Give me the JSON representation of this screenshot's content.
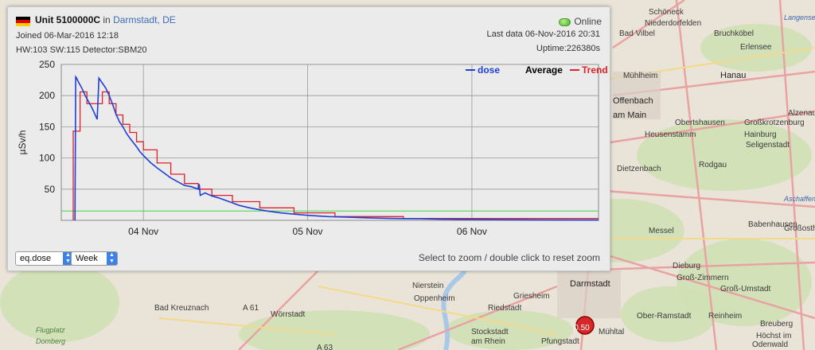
{
  "map": {
    "labels": [
      "Schöneck",
      "Niederdorfelden",
      "Bruchköbel",
      "Bad Vilbel",
      "Erlensee",
      "Mühlheim",
      "Hanau",
      "Offenbach",
      "am Main",
      "Obertshausen",
      "Großkrotzenburg",
      "Alzenau",
      "Hainburg",
      "Heusenstamm",
      "Seligenstadt",
      "Dietzenbach",
      "Rodgau",
      "Babenhausen",
      "Messel",
      "Dieburg",
      "Groß-Zimmern",
      "Groß-Umstadt",
      "Darmstadt",
      "Griesheim",
      "Nierstein",
      "Oppenheim",
      "Riedstadt",
      "Bad Kreuznach",
      "Wörrstadt",
      "Stockstadt",
      "am Rhein",
      "Pfungstadt",
      "Mühltal",
      "Ober-Ramstadt",
      "Reinheim",
      "Breuberg",
      "Höchst im",
      "Odenwald",
      "Langenselbold",
      "Flugplatz",
      "Domberg",
      "Aschaffenburg",
      "Großostheim",
      "A 61",
      "A 63",
      "0.50"
    ]
  },
  "panel": {
    "unit_name": "Unit 5100000C",
    "in_word": "in",
    "location": "Darmstadt, DE",
    "status": "Online",
    "joined": "Joined 06-Mar-2016 12:18",
    "hw_info": "HW:103 SW:115 Detector:SBM20",
    "last_data": "Last data 06-Nov-2016 20:31",
    "uptime": "Uptime:226380s",
    "select_type": "eq.dose",
    "select_range": "Week",
    "zoom_hint": "Select to zoom / double click to reset zoom"
  },
  "colors": {
    "dose": "#1f3fd6",
    "trend": "#e0202a",
    "threshold": "#44d144",
    "flag_black": "#000000",
    "flag_red": "#dd0000",
    "flag_gold": "#ffce00"
  },
  "chart_data": {
    "type": "line",
    "ylabel": "µSv/h",
    "ylim": [
      0,
      250
    ],
    "yticks": [
      50,
      100,
      150,
      200,
      250
    ],
    "xlim_hours": [
      0,
      157
    ],
    "xticks": [
      {
        "label": "04 Nov",
        "h": 24
      },
      {
        "label": "05 Nov",
        "h": 72
      },
      {
        "label": "06 Nov",
        "h": 120
      }
    ],
    "legend": [
      {
        "label": "dose",
        "color": "#1f3fd6"
      },
      {
        "label": "Average",
        "color": "#000000"
      },
      {
        "label": "Trend",
        "color": "#e0202a"
      }
    ],
    "threshold": 15,
    "series": [
      {
        "name": "dose",
        "x": [
          4,
          4.2,
          4.5,
          5,
          6,
          7,
          8,
          9,
          10,
          10.5,
          11,
          12,
          13,
          14,
          15,
          16,
          17,
          18,
          19,
          20,
          21,
          22,
          23,
          24,
          26,
          28,
          30,
          32,
          34,
          36,
          38,
          40,
          40.3,
          40.6,
          42,
          44,
          46,
          48,
          50,
          52,
          55,
          58,
          60,
          64,
          68,
          72,
          78,
          84,
          90,
          96,
          105,
          110,
          120,
          130,
          140,
          157
        ],
        "y": [
          0,
          230,
          228,
          222,
          212,
          200,
          190,
          180,
          168,
          162,
          228,
          220,
          212,
          200,
          186,
          170,
          158,
          150,
          140,
          132,
          125,
          118,
          110,
          104,
          93,
          84,
          76,
          68,
          62,
          56,
          54,
          50,
          58,
          40,
          44,
          39,
          36,
          32,
          28,
          24,
          20,
          17,
          15,
          12,
          10,
          8,
          6,
          5,
          4,
          3,
          2.5,
          2,
          1.5,
          1,
          0.8,
          0.5
        ]
      },
      {
        "name": "Trend",
        "x": [
          3.5,
          3.5,
          5.5,
          5.5,
          7.5,
          7.5,
          10,
          10,
          12,
          12,
          14,
          14,
          16,
          16,
          18,
          18,
          20,
          20,
          22,
          22,
          24,
          24,
          28,
          28,
          32,
          32,
          36,
          36,
          40,
          40,
          44,
          44,
          50,
          50,
          58,
          58,
          68,
          68,
          80,
          80,
          100,
          100,
          157
        ],
        "y": [
          0,
          143,
          143,
          206,
          206,
          187,
          187,
          187,
          187,
          206,
          206,
          187,
          187,
          169,
          169,
          154,
          154,
          141,
          141,
          126,
          126,
          113,
          113,
          92,
          92,
          74,
          74,
          59,
          59,
          50,
          50,
          40,
          40,
          30,
          30,
          20,
          20,
          12,
          12,
          6,
          6,
          3,
          3
        ]
      }
    ]
  }
}
